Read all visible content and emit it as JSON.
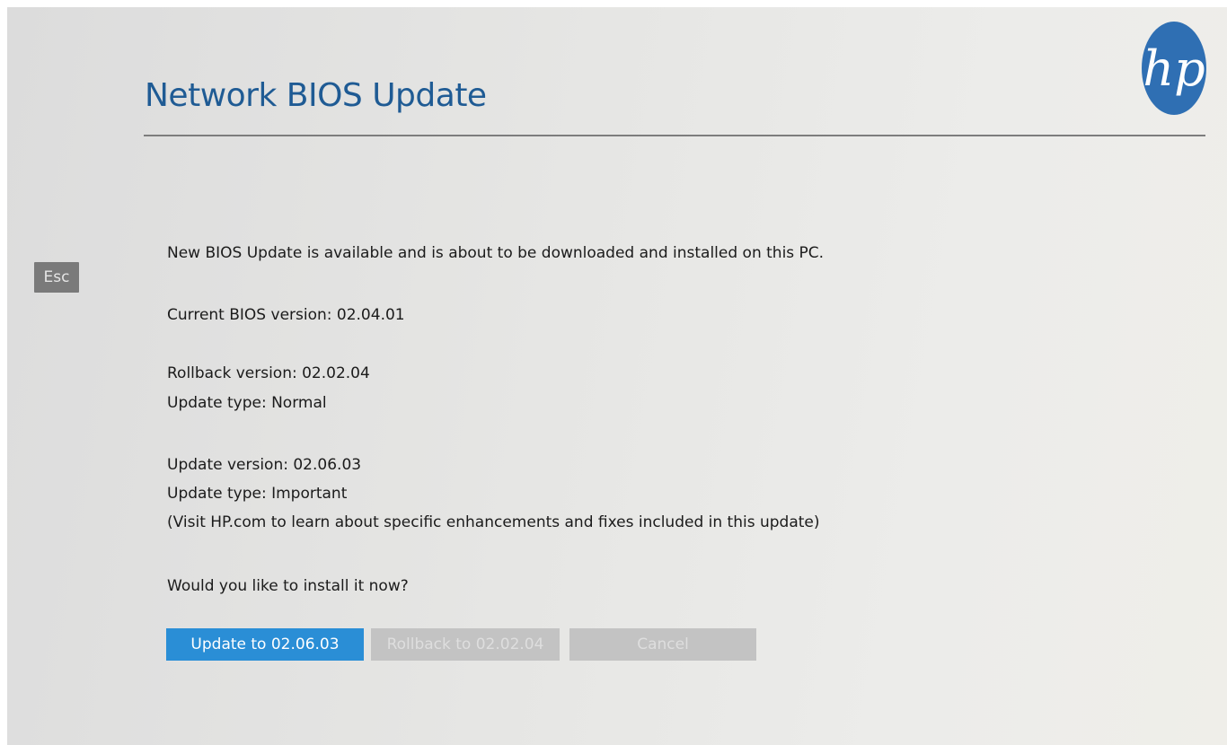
{
  "header": {
    "title": "Network BIOS Update",
    "logo_text": "hp",
    "brand_color": "#2f6fb3"
  },
  "esc_key": {
    "label": "Esc"
  },
  "message": {
    "intro": "New BIOS Update is available and is about to be downloaded and installed on this PC.",
    "current_version": "Current BIOS version: 02.04.01",
    "rollback_version": "Rollback version: 02.02.04",
    "rollback_type": "Update type: Normal",
    "update_version": "Update version: 02.06.03",
    "update_type": "Update type: Important",
    "update_note": "(Visit HP.com to learn about specific enhancements and fixes included in this update)",
    "question": "Would you like to install it now?"
  },
  "buttons": {
    "update_label": "Update to 02.06.03",
    "rollback_label": "Rollback to 02.02.04",
    "cancel_label": "Cancel",
    "update_color": "#2a8ed6",
    "disabled_color": "#c3c3c3"
  }
}
